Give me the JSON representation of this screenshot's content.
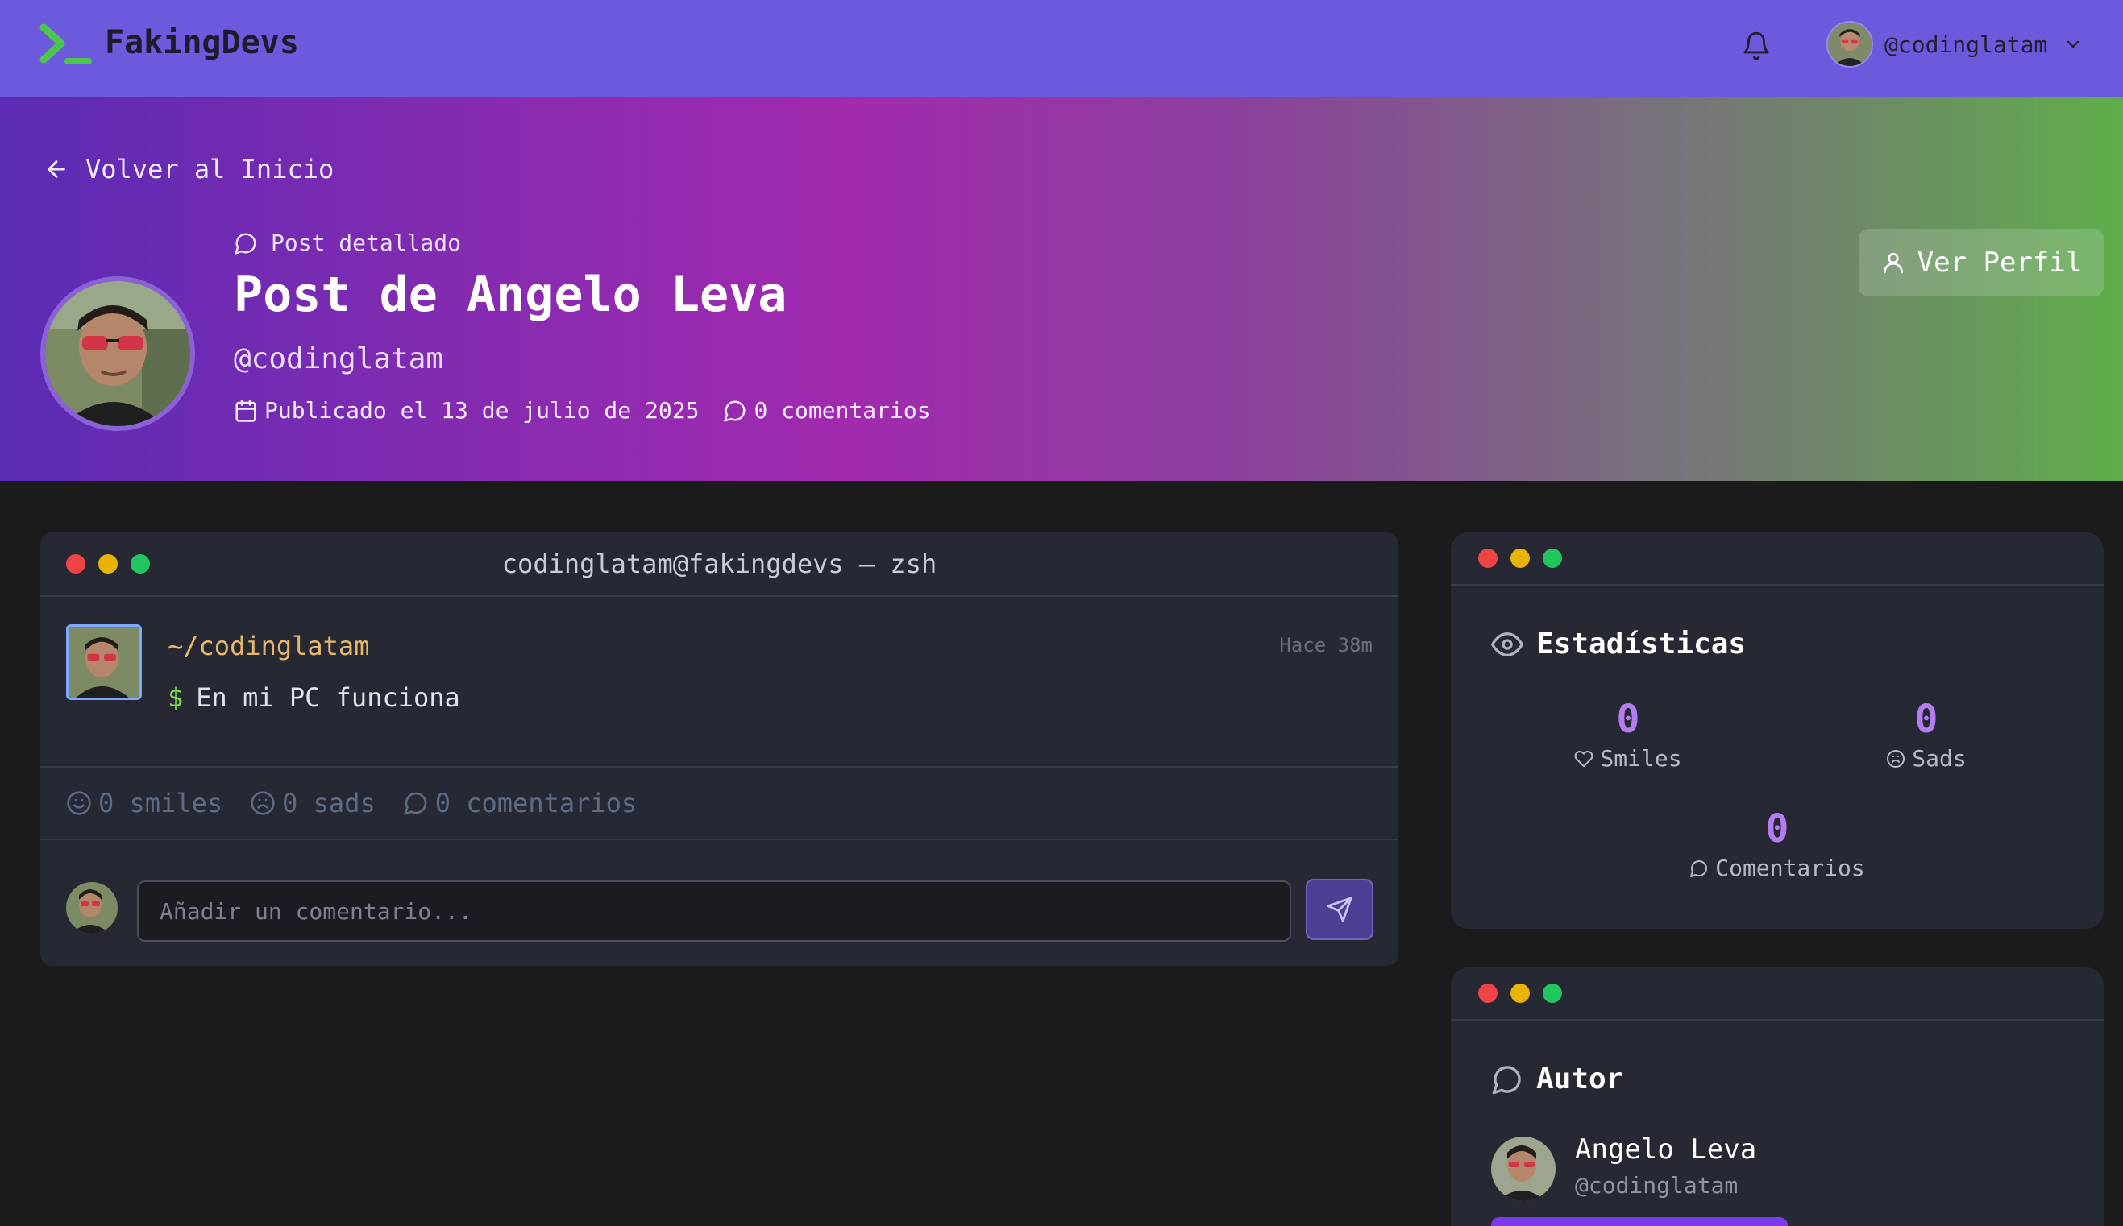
{
  "header": {
    "brand": "FakingDevs",
    "user_handle": "@codinglatam"
  },
  "hero": {
    "back_label": "Volver al Inicio",
    "tag": "Post detallado",
    "title": "Post de Angelo Leva",
    "handle": "@codinglatam",
    "published": "Publicado el 13 de julio de 2025",
    "comments": "0 comentarios",
    "view_profile": "Ver Perfil"
  },
  "terminal": {
    "title": "codinglatam@fakingdevs — zsh",
    "path": "~/codinglatam",
    "time": "Hace 38m",
    "prompt": "$",
    "content": "En mi PC funciona",
    "reactions": {
      "smiles": "0 smiles",
      "sads": "0 sads",
      "comments": "0 comentarios"
    },
    "comment_placeholder": "Añadir un comentario..."
  },
  "stats": {
    "title": "Estadísticas",
    "smiles_value": "0",
    "smiles_label": "Smiles",
    "sads_value": "0",
    "sads_label": "Sads",
    "comments_value": "0",
    "comments_label": "Comentarios"
  },
  "author": {
    "title": "Autor",
    "name": "Angelo Leva",
    "handle": "@codinglatam"
  },
  "colors": {
    "topbar": "#6b5bdc",
    "accent": "#b57cf0",
    "background": "#1b1b1c",
    "panel": "#262833"
  },
  "icons": [
    "terminal-logo-icon",
    "bell-icon",
    "chevron-down-icon",
    "arrow-left-icon",
    "message-icon",
    "calendar-icon",
    "user-icon",
    "smile-icon",
    "frown-icon",
    "send-icon",
    "eye-icon",
    "heart-icon"
  ]
}
